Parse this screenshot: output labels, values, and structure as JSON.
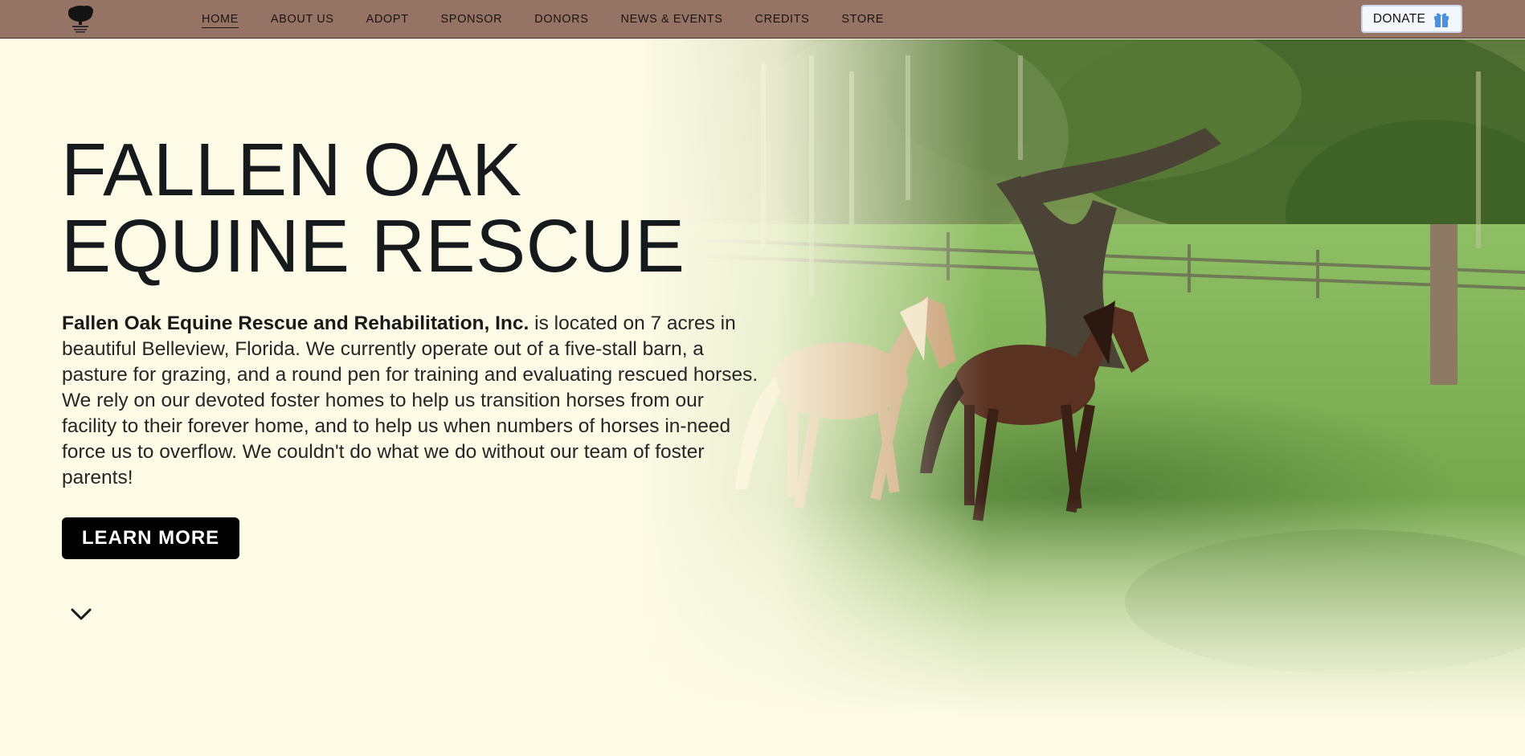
{
  "nav": {
    "items": [
      {
        "label": "HOME",
        "active": true
      },
      {
        "label": "ABOUT US"
      },
      {
        "label": "ADOPT"
      },
      {
        "label": "SPONSOR"
      },
      {
        "label": "DONORS"
      },
      {
        "label": "NEWS & EVENTS"
      },
      {
        "label": "CREDITS"
      },
      {
        "label": "STORE"
      }
    ],
    "donate_label": "DONATE",
    "logo_icon": "oak-tree-logo-icon",
    "donate_icon": "gift-icon"
  },
  "hero": {
    "title_line1": "FALLEN OAK",
    "title_line2": "EQUINE RESCUE",
    "org_name": "Fallen Oak Equine Rescue and Rehabilitation, Inc.",
    "description": " is located on 7 acres in beautiful Belleview, Florida. We currently operate out of a five-stall barn, a pasture for grazing, and a round pen for training and evaluating rescued horses. We rely on our devoted foster homes to help us transition horses from our facility to their forever home, and to help us when numbers of horses in-need force us to overflow. We couldn't do what we do without our team of foster parents!",
    "cta_label": "LEARN MORE",
    "scroll_icon": "chevron-down-icon",
    "image_subject": "two horses running under an oak tree with Spanish moss"
  },
  "colors": {
    "nav_bg": "#957365",
    "page_bg": "#fdfbe6",
    "button_bg": "#000000",
    "donate_bg": "#f3f6fb",
    "gift_icon": "#4b8fe0"
  }
}
